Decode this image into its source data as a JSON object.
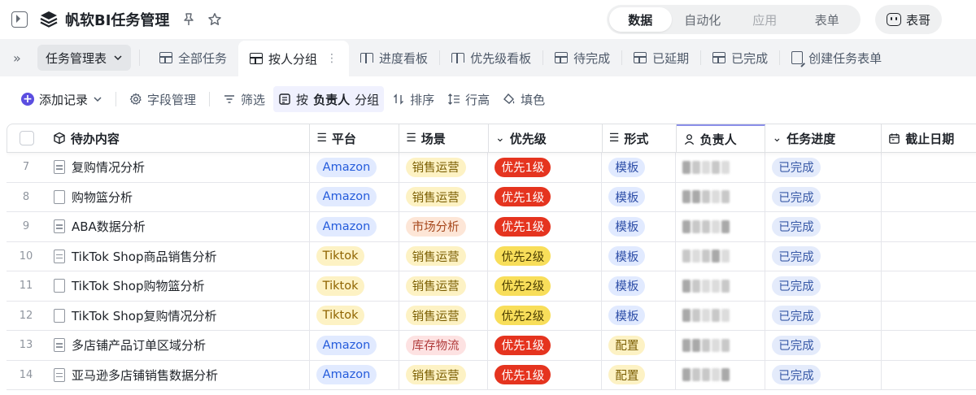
{
  "app": {
    "title": "帆软BI任务管理",
    "modes": [
      {
        "label": "数据",
        "state": "active"
      },
      {
        "label": "自动化",
        "state": "normal"
      },
      {
        "label": "应用",
        "state": "disabled"
      },
      {
        "label": "表单",
        "state": "normal"
      }
    ],
    "user_label": "表哥"
  },
  "tabbar": {
    "table_name": "任务管理表",
    "tabs": [
      {
        "label": "全部任务",
        "icon": "grid-icon"
      },
      {
        "label": "按人分组",
        "icon": "grid-icon",
        "active": true
      },
      {
        "label": "进度看板",
        "icon": "kanban-icon"
      },
      {
        "label": "优先级看板",
        "icon": "kanban-icon"
      },
      {
        "label": "待完成",
        "icon": "grid-icon"
      },
      {
        "label": "已延期",
        "icon": "grid-icon"
      },
      {
        "label": "已完成",
        "icon": "grid-icon"
      },
      {
        "label": "创建任务表单",
        "icon": "form-icon"
      }
    ]
  },
  "toolbar": {
    "add_record": "添加记录",
    "field_manage": "字段管理",
    "filter": "筛选",
    "group_prefix": "按",
    "group_field": "负责人",
    "group_suffix": "分组",
    "sort": "排序",
    "row_height": "行高",
    "fill": "填色"
  },
  "table": {
    "columns": [
      "待办内容",
      "平台",
      "场景",
      "优先级",
      "形式",
      "负责人",
      "任务进度",
      "截止日期"
    ],
    "rows": [
      {
        "idx": "7",
        "name": "复购情况分析",
        "doc": true,
        "platform": "Amazon",
        "scene": "销售运营",
        "priority": "优先1级",
        "form": "模板",
        "progress": "已完成"
      },
      {
        "idx": "8",
        "name": "购物篮分析",
        "doc": false,
        "platform": "Amazon",
        "scene": "销售运营",
        "priority": "优先1级",
        "form": "模板",
        "progress": "已完成"
      },
      {
        "idx": "9",
        "name": "ABA数据分析",
        "doc": true,
        "platform": "Amazon",
        "scene": "市场分析",
        "priority": "优先1级",
        "form": "模板",
        "progress": "已完成"
      },
      {
        "idx": "10",
        "name": "TikTok Shop商品销售分析",
        "doc": true,
        "platform": "Tiktok",
        "scene": "销售运营",
        "priority": "优先2级",
        "form": "模板",
        "progress": "已完成"
      },
      {
        "idx": "11",
        "name": "TikTok Shop购物篮分析",
        "doc": false,
        "platform": "Tiktok",
        "scene": "销售运营",
        "priority": "优先2级",
        "form": "模板",
        "progress": "已完成"
      },
      {
        "idx": "12",
        "name": "TikTok Shop复购情况分析",
        "doc": false,
        "platform": "Tiktok",
        "scene": "销售运营",
        "priority": "优先2级",
        "form": "模板",
        "progress": "已完成"
      },
      {
        "idx": "13",
        "name": "多店铺产品订单区域分析",
        "doc": true,
        "platform": "Amazon",
        "scene": "库存物流",
        "priority": "优先1级",
        "form": "配置",
        "progress": "已完成"
      },
      {
        "idx": "14",
        "name": "亚马逊多店铺销售数据分析",
        "doc": true,
        "platform": "Amazon",
        "scene": "销售运营",
        "priority": "优先1级",
        "form": "配置",
        "progress": "已完成"
      }
    ]
  }
}
